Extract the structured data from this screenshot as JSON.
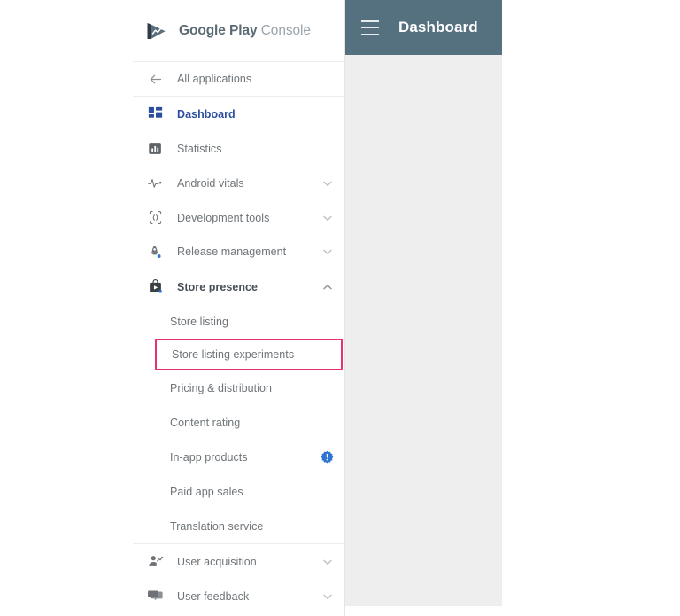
{
  "brand": {
    "logo_icon": "google-play-logo-icon",
    "name_bold": "Google Play",
    "name_light": "Console"
  },
  "topbar": {
    "menu_icon": "hamburger-menu-icon",
    "title": "Dashboard"
  },
  "colors": {
    "topbar_background": "#55707e",
    "content_background": "#eeeeee",
    "sidebar_background": "#ffffff",
    "active_item": "#2b4f9e",
    "highlight_box": "#e8336a",
    "badge_blue": "#2f74d0",
    "label_gray": "#6e7478"
  },
  "sidebar": {
    "back_item": {
      "label": "All applications",
      "icon": "arrow-left-icon"
    },
    "items": [
      {
        "label": "Dashboard",
        "icon": "dashboard-grid-icon",
        "active": true,
        "expandable": false,
        "badge": null
      },
      {
        "label": "Statistics",
        "icon": "statistics-bar-chart-icon",
        "active": false,
        "expandable": false,
        "badge": null
      },
      {
        "label": "Android vitals",
        "icon": "pulse-heartbeat-icon",
        "active": false,
        "expandable": true,
        "expanded": false,
        "badge": null
      },
      {
        "label": "Development tools",
        "icon": "code-braces-phone-icon",
        "active": false,
        "expandable": true,
        "expanded": false,
        "badge": null
      },
      {
        "label": "Release management",
        "icon": "rocket-icon",
        "active": false,
        "expandable": true,
        "expanded": false,
        "badge": "blue-dot"
      },
      {
        "label": "Store presence",
        "icon": "store-bag-play-icon",
        "active": false,
        "expandable": true,
        "expanded": true,
        "badge": "blue-dot"
      }
    ],
    "store_presence_subitems": [
      {
        "label": "Store listing",
        "highlighted": false,
        "badge": null
      },
      {
        "label": "Store listing experiments",
        "highlighted": true,
        "badge": null
      },
      {
        "label": "Pricing & distribution",
        "highlighted": false,
        "badge": null
      },
      {
        "label": "Content rating",
        "highlighted": false,
        "badge": null
      },
      {
        "label": "In-app products",
        "highlighted": false,
        "badge": "alert-exclamation-badge-icon"
      },
      {
        "label": "Paid app sales",
        "highlighted": false,
        "badge": null
      },
      {
        "label": "Translation service",
        "highlighted": false,
        "badge": null
      }
    ],
    "bottom_items": [
      {
        "label": "User acquisition",
        "icon": "user-trend-icon",
        "expandable": true,
        "expanded": false
      },
      {
        "label": "User feedback",
        "icon": "chat-bubbles-icon",
        "expandable": true,
        "expanded": false
      }
    ]
  }
}
